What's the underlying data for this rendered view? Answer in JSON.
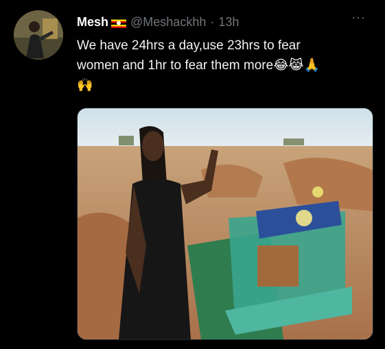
{
  "author": {
    "name": "Mesh",
    "handle": "@Meshackhh",
    "separator": "·",
    "time": "13h"
  },
  "tweet": {
    "line1": "We have 24hrs a day,use 23hrs to fear",
    "line2": "women and 1hr to fear them more",
    "line2_emojis": "😂😹🙏",
    "line3_emoji": "🙌"
  },
  "more_label": "···",
  "icons": {
    "avatar": "profile-photo",
    "flag": "uganda-flag-icon",
    "more": "more-options-icon"
  },
  "colors": {
    "background": "#000000",
    "text": "#e7e9ea",
    "secondary": "#71767b"
  }
}
